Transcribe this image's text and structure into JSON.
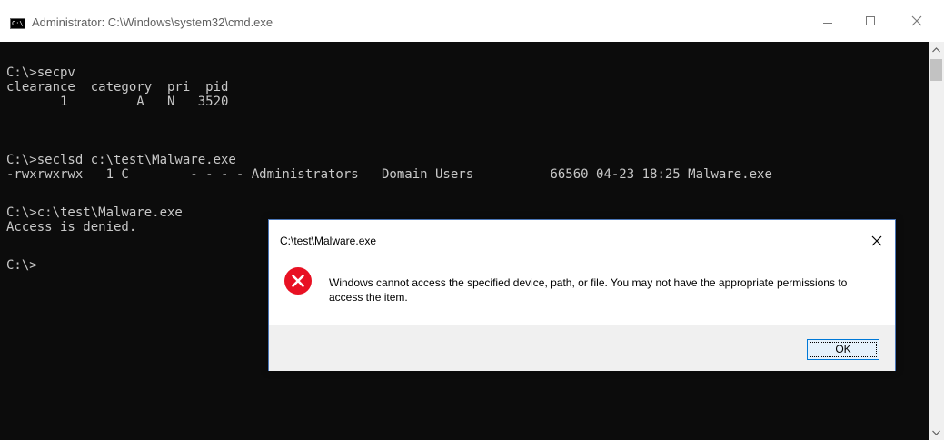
{
  "window": {
    "title": "Administrator: C:\\Windows\\system32\\cmd.exe",
    "icon": "cmd-icon"
  },
  "console": {
    "lines": [
      "C:\\>secpv",
      "clearance  category  pri  pid",
      "       1         A   N   3520",
      "C:\\>seclsd c:\\test\\Malware.exe",
      "-rwxrwxrwx   1 C        - - - - Administrators   Domain Users          66560 04-23 18:25 Malware.exe",
      "C:\\>c:\\test\\Malware.exe",
      "Access is denied.",
      "C:\\>"
    ]
  },
  "dialog": {
    "title": "C:\\test\\Malware.exe",
    "message": "Windows cannot access the specified device, path, or file. You may not have the appropriate permissions to access the item.",
    "ok_label": "OK",
    "icon": "error-icon"
  },
  "colors": {
    "console_bg": "#0c0c0c",
    "console_text": "#c8c8c8",
    "error_red": "#e81123",
    "button_accent": "#0078d7"
  }
}
